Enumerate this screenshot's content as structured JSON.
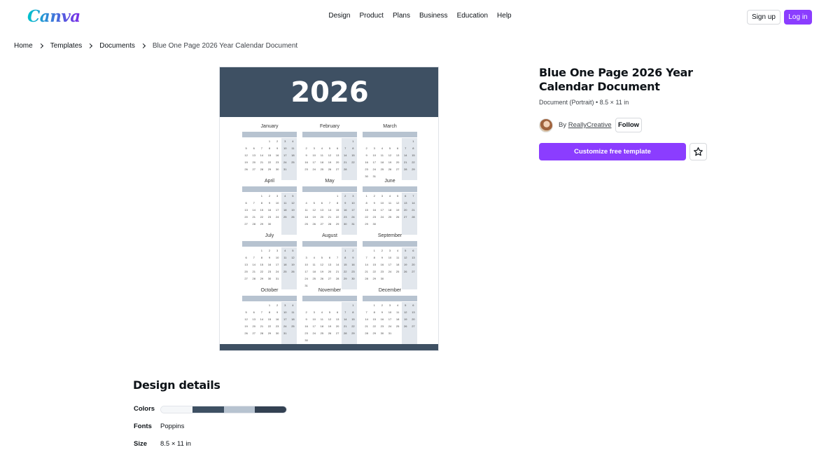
{
  "header": {
    "logo": "Canva",
    "nav": [
      "Design",
      "Product",
      "Plans",
      "Business",
      "Education",
      "Help"
    ],
    "signup": "Sign up",
    "login": "Log in"
  },
  "breadcrumb": [
    "Home",
    "Templates",
    "Documents",
    "Blue One Page 2026 Year Calendar Document"
  ],
  "preview": {
    "year": "2026",
    "weekdays": [
      "Mon",
      "Tue",
      "Wed",
      "Thu",
      "Fri",
      "Sat",
      "Sun"
    ],
    "months": [
      {
        "name": "January",
        "start": 3,
        "days": 31
      },
      {
        "name": "February",
        "start": 6,
        "days": 28
      },
      {
        "name": "March",
        "start": 6,
        "days": 31
      },
      {
        "name": "April",
        "start": 2,
        "days": 30
      },
      {
        "name": "May",
        "start": 4,
        "days": 31
      },
      {
        "name": "June",
        "start": 0,
        "days": 30
      },
      {
        "name": "July",
        "start": 2,
        "days": 31
      },
      {
        "name": "August",
        "start": 5,
        "days": 31
      },
      {
        "name": "September",
        "start": 1,
        "days": 30
      },
      {
        "name": "October",
        "start": 3,
        "days": 31
      },
      {
        "name": "November",
        "start": 6,
        "days": 30
      },
      {
        "name": "December",
        "start": 1,
        "days": 31
      }
    ]
  },
  "template": {
    "title": "Blue One Page 2026 Year Calendar Document",
    "meta": "Document (Portrait) • 8.5 × 11 in",
    "by": "By",
    "author": "ReallyCreative",
    "follow": "Follow",
    "customize": "Customize free template",
    "star_icon": "star-outline-icon"
  },
  "design_details": {
    "title": "Design details",
    "colors_label": "Colors",
    "colors": [
      "#f5f7f9",
      "#3e5063",
      "#b7c3d0",
      "#334152"
    ],
    "fonts_label": "Fonts",
    "fonts_value": "Poppins",
    "size_label": "Size",
    "size_value": "8.5 × 11 in"
  },
  "colors": {
    "accent": "#8b3dff",
    "calendar_banner": "#3e5063",
    "weekday_bar": "#b7c3d0"
  }
}
